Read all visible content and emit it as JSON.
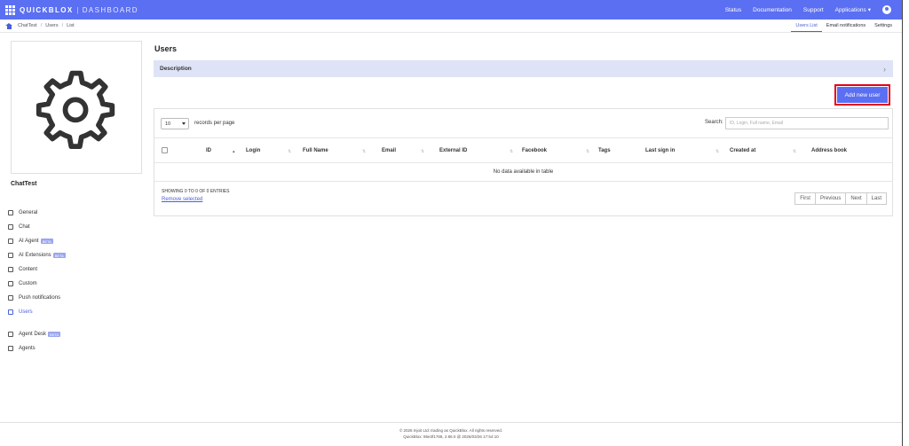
{
  "topbar": {
    "brand": "QUICKBLOX",
    "section": "DASHBOARD",
    "nav": [
      "Status",
      "Documentation",
      "Support",
      "Applications"
    ],
    "applications_caret": "▾",
    "color": "#5b6ff2"
  },
  "breadcrumb": [
    "ChatTest",
    "Users",
    "List"
  ],
  "subtabs": [
    {
      "label": "Users List",
      "active": true
    },
    {
      "label": "Email notifications",
      "active": false
    },
    {
      "label": "Settings",
      "active": false
    }
  ],
  "app": {
    "name": "ChatTest",
    "icon": "gear-icon"
  },
  "sidebar": {
    "items": [
      {
        "label": "General",
        "icon": "database-icon"
      },
      {
        "label": "Chat",
        "icon": "chat-icon"
      },
      {
        "label": "AI Agent",
        "icon": "ai-agent-icon",
        "badge": "BETA"
      },
      {
        "label": "AI Extensions",
        "icon": "ai-extensions-icon",
        "badge": "BETA"
      },
      {
        "label": "Content",
        "icon": "content-icon"
      },
      {
        "label": "Custom",
        "icon": "custom-icon"
      },
      {
        "label": "Push notifications",
        "icon": "bell-icon"
      },
      {
        "label": "Users",
        "icon": "users-icon",
        "active": true
      }
    ],
    "bottom_items": [
      {
        "label": "Agent Desk",
        "icon": "agent-desk-icon",
        "badge": "BETA"
      },
      {
        "label": "Agents",
        "icon": "agents-icon"
      }
    ]
  },
  "main": {
    "title": "Users",
    "description_label": "Description",
    "description_chevron": "›",
    "add_button": "Add new user",
    "page_length": "10",
    "records_label": "records per page",
    "search_label": "Search:",
    "search_placeholder": "ID, Login, Full name, Email",
    "columns": [
      "ID",
      "Login",
      "Full Name",
      "Email",
      "External ID",
      "Facebook",
      "Tags",
      "Last sign in",
      "Created at",
      "Address book"
    ],
    "sort_arrow": "⇅",
    "sort_arrow_active": "▴",
    "empty_text": "No data available in table",
    "entries_info": "SHOWING 0 TO 0 OF 0 ENTRIES",
    "remove_selected": "Remove selected",
    "pagination": [
      "First",
      "Previous",
      "Next",
      "Last"
    ]
  },
  "footer": {
    "line1": "© 2026 Injoit Ltd. trading as QuickBlox. All rights reserved.",
    "line2": "QuickBlox: 95e3f1768, 2.86.0 @ 2026/03/26 17:54:10"
  }
}
